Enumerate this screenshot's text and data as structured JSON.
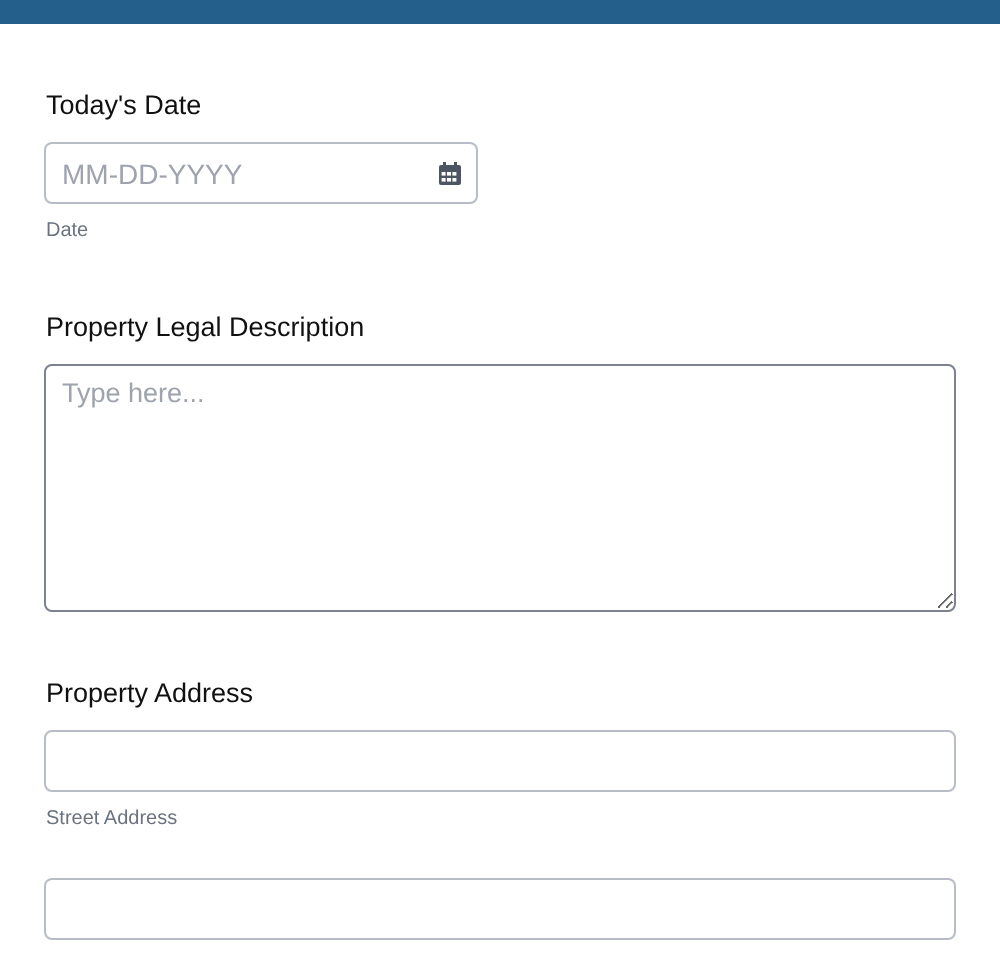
{
  "fields": [
    {
      "label": "Today's Date",
      "inputs": [
        {
          "kind": "date",
          "placeholder": "MM-DD-YYYY",
          "sublabel": "Date"
        }
      ]
    },
    {
      "label": "Property Legal Description",
      "inputs": [
        {
          "kind": "textarea",
          "placeholder": "Type here..."
        }
      ]
    },
    {
      "label": "Property Address",
      "inputs": [
        {
          "kind": "text",
          "sublabel": "Street Address"
        },
        {
          "kind": "text"
        }
      ]
    }
  ]
}
